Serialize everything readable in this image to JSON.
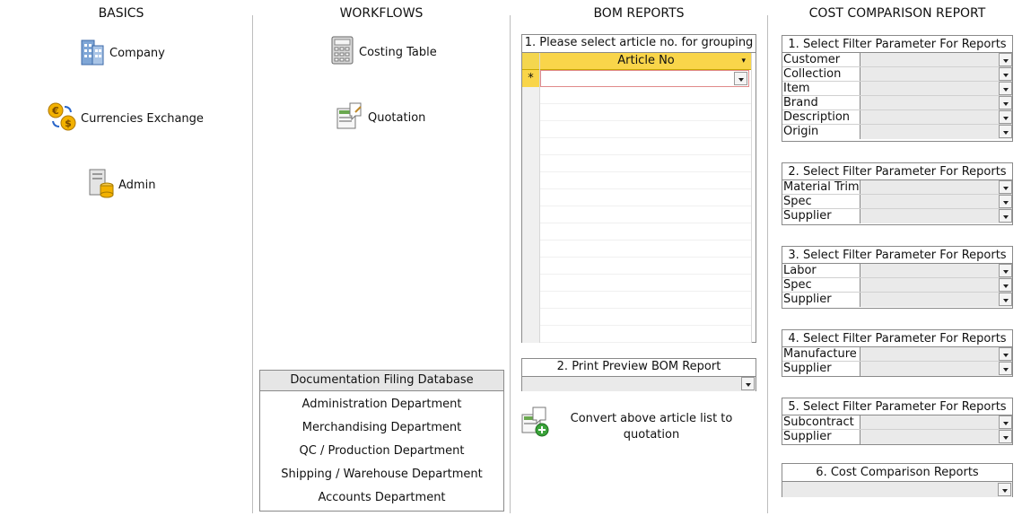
{
  "columns": {
    "basics": "BASICS",
    "workflows": "WORKFLOWS",
    "bom": "BOM REPORTS",
    "cost": "COST COMPARISON REPORT"
  },
  "basics": {
    "company": "Company",
    "currencies": "Currencies Exchange",
    "admin": "Admin"
  },
  "workflows": {
    "costing": "Costing Table",
    "quotation": "Quotation"
  },
  "documentation": {
    "title": "Documentation Filing Database",
    "items": [
      "Administration Department",
      "Merchandising Department",
      "QC / Production Department",
      "Shipping / Warehouse Department",
      "Accounts Department"
    ]
  },
  "bom": {
    "grouping_title": "1. Please select article no. for grouping",
    "column_header": "Article No",
    "new_row_marker": "*",
    "print_title": "2. Print Preview BOM Report",
    "convert_label": "Convert above article list to quotation"
  },
  "cost": {
    "filter1": {
      "title": "1. Select Filter Parameter For Reports",
      "fields": [
        "Customer",
        "Collection",
        "Item",
        "Brand",
        "Description",
        "Origin"
      ]
    },
    "filter2": {
      "title": "2. Select Filter Parameter For Reports",
      "fields": [
        "Material Trim",
        "Spec",
        "Supplier"
      ]
    },
    "filter3": {
      "title": "3. Select Filter Parameter For Reports",
      "fields": [
        "Labor",
        "Spec",
        "Supplier"
      ]
    },
    "filter4": {
      "title": "4. Select Filter Parameter For Reports",
      "fields": [
        "Manufacture",
        "Supplier"
      ]
    },
    "filter5": {
      "title": "5. Select Filter Parameter For Reports",
      "fields": [
        "Subcontract",
        "Supplier"
      ]
    },
    "reports_title": "6. Cost Comparison Reports"
  }
}
